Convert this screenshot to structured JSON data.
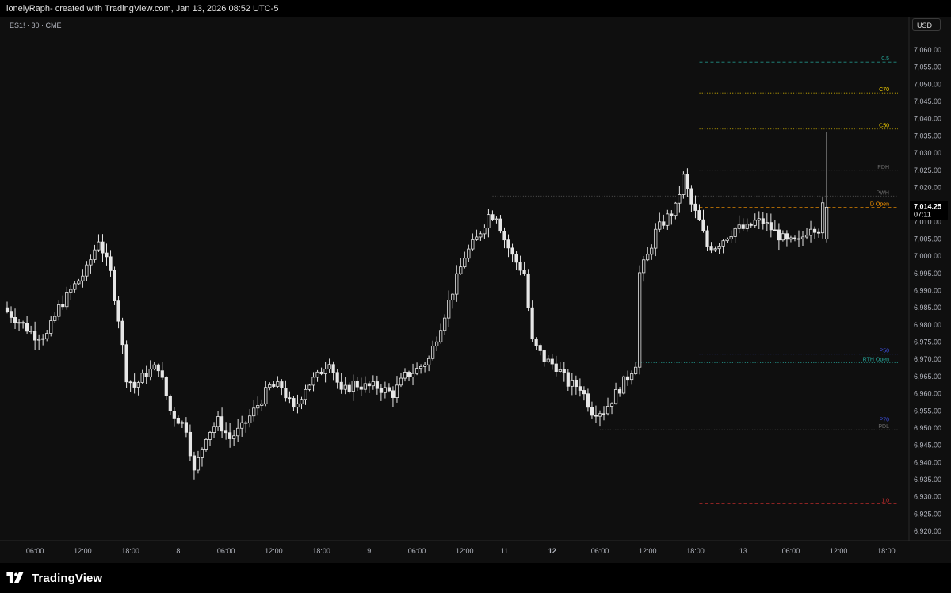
{
  "header": {
    "caption": "lonelyRaph- created with TradingView.com, Jan 13, 2026 08:52 UTC-5"
  },
  "symbol": {
    "text": "ES1! · 30 · CME"
  },
  "currency": {
    "label": "USD"
  },
  "footer": {
    "brand": "TradingView"
  },
  "colors": {
    "background": "#0f0f0f",
    "candle": "#e6e6e6",
    "pdh": "#6e6e6e",
    "pwh": "#6e6e6e",
    "dopen": "#ff9800",
    "c50": "#f5d000",
    "c70": "#f5d000",
    "half": "#26a69a",
    "p50": "#3f51e6",
    "p70": "#3f51e6",
    "rth": "#26a69a",
    "pdl": "#6e6e6e",
    "one": "#d32f2f"
  },
  "chart_data": {
    "type": "candlestick",
    "title": "",
    "xlabel": "",
    "ylabel": "",
    "timeframe": "30",
    "ylim": [
      6915,
      7063
    ],
    "grid": false,
    "y_ticks": [
      "7,060.00",
      "7,055.00",
      "7,050.00",
      "7,045.00",
      "7,040.00",
      "7,035.00",
      "7,030.00",
      "7,025.00",
      "7,020.00",
      "7,015.00",
      "7,010.00",
      "7,005.00",
      "7,000.00",
      "6,995.00",
      "6,990.00",
      "6,985.00",
      "6,980.00",
      "6,975.00",
      "6,970.00",
      "6,965.00",
      "6,960.00",
      "6,955.00",
      "6,950.00",
      "6,945.00",
      "6,940.00",
      "6,935.00",
      "6,930.00",
      "6,925.00",
      "6,920.00"
    ],
    "x_ticks": [
      {
        "index": 7,
        "label": "06:00",
        "bold": false
      },
      {
        "index": 19,
        "label": "12:00",
        "bold": false
      },
      {
        "index": 31,
        "label": "18:00",
        "bold": false
      },
      {
        "index": 43,
        "label": "8",
        "bold": false
      },
      {
        "index": 55,
        "label": "06:00",
        "bold": false
      },
      {
        "index": 67,
        "label": "12:00",
        "bold": false
      },
      {
        "index": 79,
        "label": "18:00",
        "bold": false
      },
      {
        "index": 91,
        "label": "9",
        "bold": false
      },
      {
        "index": 103,
        "label": "06:00",
        "bold": false
      },
      {
        "index": 115,
        "label": "12:00",
        "bold": false
      },
      {
        "index": 125,
        "label": "11",
        "bold": false
      },
      {
        "index": 137,
        "label": "12",
        "bold": true
      },
      {
        "index": 149,
        "label": "06:00",
        "bold": false
      },
      {
        "index": 161,
        "label": "12:00",
        "bold": false
      },
      {
        "index": 173,
        "label": "18:00",
        "bold": false
      },
      {
        "index": 185,
        "label": "13",
        "bold": false
      },
      {
        "index": 197,
        "label": "06:00",
        "bold": false
      },
      {
        "index": 209,
        "label": "12:00",
        "bold": false
      },
      {
        "index": 221,
        "label": "18:00",
        "bold": false
      }
    ],
    "levels": [
      {
        "name": "0.5",
        "label": "0.5",
        "value": 7056.5,
        "style": "dashed",
        "colorKey": "half",
        "start_index": 174
      },
      {
        "name": "C70",
        "label": "C70",
        "value": 7047.5,
        "style": "dotted",
        "colorKey": "c70",
        "start_index": 174
      },
      {
        "name": "C50",
        "label": "C50",
        "value": 7037,
        "style": "dotted",
        "colorKey": "c50",
        "start_index": 174
      },
      {
        "name": "PDH",
        "label": "PDH",
        "value": 7025,
        "style": "dotted",
        "colorKey": "pdh",
        "start_index": 174
      },
      {
        "name": "PWH",
        "label": "PWH",
        "value": 7017.5,
        "style": "dotted",
        "colorKey": "pwh",
        "start_index": 122
      },
      {
        "name": "D Open",
        "label": "D Open",
        "value": 7014.25,
        "style": "dashed",
        "colorKey": "dopen",
        "start_index": 174
      },
      {
        "name": "P50",
        "label": "P50",
        "value": 6971.5,
        "style": "dotted",
        "colorKey": "p50",
        "start_index": 174
      },
      {
        "name": "RTH Open",
        "label": "RTH Open",
        "value": 6969,
        "style": "dotted",
        "colorKey": "rth",
        "start_index": 158
      },
      {
        "name": "P70",
        "label": "P70",
        "value": 6951.5,
        "style": "dotted",
        "colorKey": "p70",
        "start_index": 174
      },
      {
        "name": "PDL",
        "label": "PDL",
        "value": 6949.5,
        "style": "dotted",
        "colorKey": "pdl",
        "start_index": 149
      },
      {
        "name": "1.0",
        "label": "1.0",
        "value": 6928,
        "style": "dashed",
        "colorKey": "one",
        "start_index": 174
      }
    ],
    "last_price": {
      "value": 7014.25,
      "label": "7,014.25",
      "countdown": "07:11"
    },
    "anchors": [
      [
        0,
        6985
      ],
      [
        4,
        6981
      ],
      [
        8,
        6977
      ],
      [
        11,
        6977
      ],
      [
        14,
        6985
      ],
      [
        17,
        6990
      ],
      [
        21,
        6996
      ],
      [
        24,
        7005
      ],
      [
        27,
        6995
      ],
      [
        29,
        6982
      ],
      [
        31,
        6965
      ],
      [
        33,
        6962
      ],
      [
        36,
        6966
      ],
      [
        39,
        6968
      ],
      [
        42,
        6955
      ],
      [
        46,
        6950
      ],
      [
        48,
        6937
      ],
      [
        51,
        6948
      ],
      [
        54,
        6952
      ],
      [
        57,
        6947
      ],
      [
        60,
        6950
      ],
      [
        63,
        6955
      ],
      [
        67,
        6962
      ],
      [
        70,
        6962
      ],
      [
        73,
        6955
      ],
      [
        76,
        6962
      ],
      [
        79,
        6965
      ],
      [
        82,
        6970
      ],
      [
        85,
        6960
      ],
      [
        88,
        6963
      ],
      [
        91,
        6962
      ],
      [
        94,
        6962
      ],
      [
        98,
        6960
      ],
      [
        101,
        6965
      ],
      [
        104,
        6967
      ],
      [
        107,
        6970
      ],
      [
        110,
        6980
      ],
      [
        113,
        6990
      ],
      [
        116,
        7000
      ],
      [
        119,
        7005
      ],
      [
        122,
        7012
      ],
      [
        124,
        7012
      ],
      [
        126,
        7005
      ],
      [
        128,
        7000
      ],
      [
        131,
        6995
      ],
      [
        133,
        6975
      ],
      [
        136,
        6970
      ],
      [
        139,
        6968
      ],
      [
        142,
        6963
      ],
      [
        145,
        6962
      ],
      [
        148,
        6955
      ],
      [
        151,
        6955
      ],
      [
        154,
        6960
      ],
      [
        157,
        6965
      ],
      [
        159,
        6969
      ],
      [
        160,
        6995
      ],
      [
        162,
        7000
      ],
      [
        164,
        7007
      ],
      [
        166,
        7010
      ],
      [
        169,
        7014
      ],
      [
        171,
        7023
      ],
      [
        173,
        7015
      ],
      [
        175,
        7010
      ],
      [
        177,
        7003
      ],
      [
        179,
        7003
      ],
      [
        181,
        7005
      ],
      [
        184,
        7008
      ],
      [
        187,
        7008
      ],
      [
        189,
        7010
      ],
      [
        191,
        7010
      ],
      [
        194,
        7007
      ],
      [
        197,
        7004
      ],
      [
        200,
        7004
      ],
      [
        203,
        7009
      ],
      [
        205,
        7008
      ],
      [
        206,
        7014.25
      ]
    ],
    "special_candles": [
      {
        "index": 206,
        "open": 7005,
        "high": 7036,
        "low": 7004,
        "close": 7014.25
      }
    ]
  }
}
